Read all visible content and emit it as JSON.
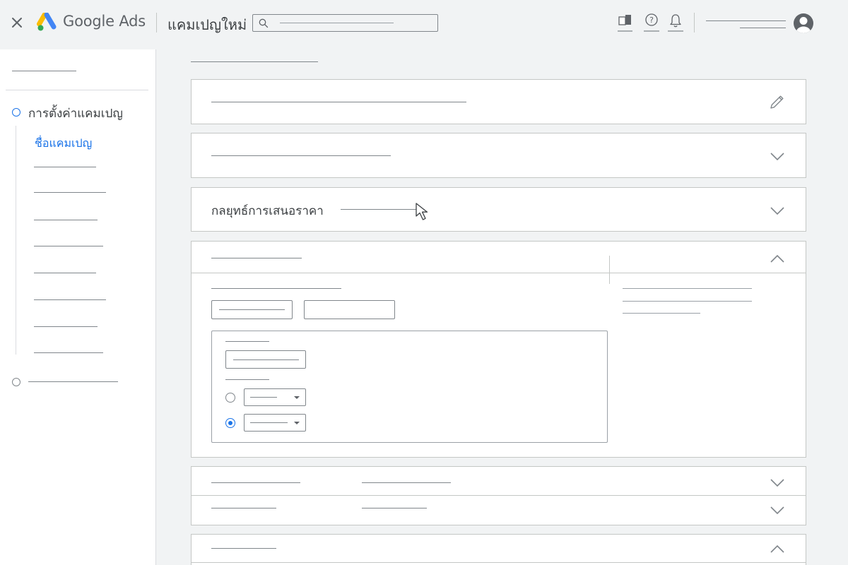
{
  "header": {
    "brand": "Google Ads",
    "campaign_title": "แคมเปญใหม่",
    "search_placeholder": ""
  },
  "sidebar": {
    "step1_label": "การตั้งค่าแคมเปญ",
    "active_item": "ชื่อแคมเปญ"
  },
  "main": {
    "bid_strategy_label": "กลยุทธ์การเสนอราคา"
  },
  "colors": {
    "accent": "#1a73e8",
    "border": "#c4c7c5",
    "background": "#f1f3f4"
  },
  "icons": [
    "close-icon",
    "google-ads-logo",
    "search-icon",
    "reports-icon",
    "help-icon",
    "notifications-icon",
    "account-avatar-icon",
    "edit-pencil-icon",
    "chevron-down-icon",
    "chevron-up-icon",
    "dropdown-arrow-icon",
    "mouse-cursor-icon"
  ]
}
